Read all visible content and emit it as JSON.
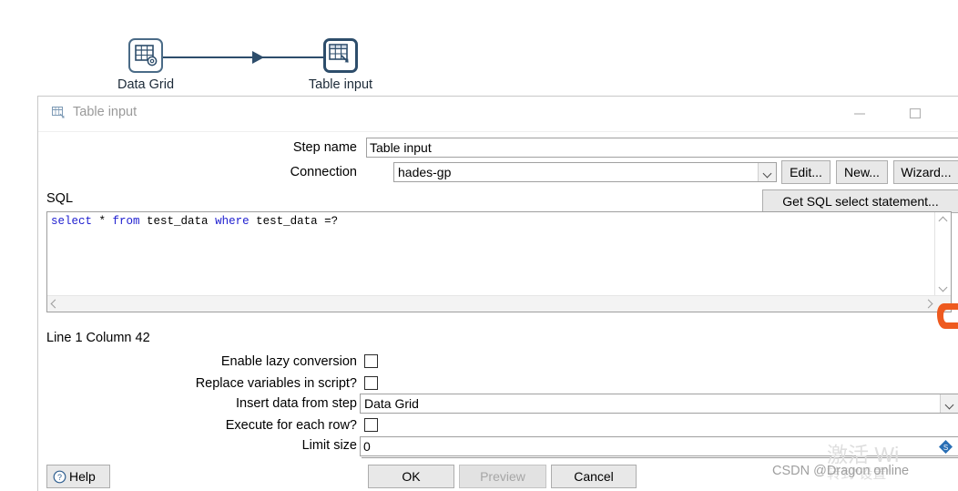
{
  "canvas": {
    "steps": [
      {
        "name": "Data Grid",
        "icon": "data-grid-icon"
      },
      {
        "name": "Table input",
        "icon": "table-input-icon"
      }
    ],
    "hop": {
      "name": "hop-arrow"
    }
  },
  "dialog": {
    "title": "Table input",
    "title_icon": "table-input-small-icon",
    "window_controls": {
      "minimize": "minimize-icon",
      "maximize": "maximize-icon",
      "close": "close-icon"
    },
    "fields": {
      "step_name_label": "Step name",
      "step_name_value": "Table input",
      "connection_label": "Connection",
      "connection_value": "hades-gp"
    },
    "connection_buttons": [
      {
        "label": "Edit...",
        "name": "edit-connection-button"
      },
      {
        "label": "New...",
        "name": "new-connection-button"
      },
      {
        "label": "Wizard...",
        "name": "connection-wizard-button"
      }
    ],
    "sql": {
      "label": "SQL",
      "get_statement_button": "Get SQL select statement...",
      "tokens": [
        {
          "t": "select",
          "kw": true
        },
        {
          "t": " * ",
          "kw": false
        },
        {
          "t": "from",
          "kw": true
        },
        {
          "t": " test_data ",
          "kw": false
        },
        {
          "t": "where",
          "kw": true
        },
        {
          "t": " test_data =?",
          "kw": false
        }
      ],
      "plain_text": "select * from test_data where test_data =?",
      "status": "Line 1 Column 42"
    },
    "options": {
      "lazy_conversion_label": "Enable lazy conversion",
      "lazy_conversion_checked": false,
      "replace_variables_label": "Replace variables in script?",
      "replace_variables_checked": false,
      "insert_data_label": "Insert data from step",
      "insert_data_value": "Data Grid",
      "execute_each_row_label": "Execute for each row?",
      "execute_each_row_checked": false,
      "limit_size_label": "Limit size",
      "limit_size_value": "0"
    },
    "footer": {
      "help_label": "Help",
      "ok_label": "OK",
      "preview_label": "Preview",
      "preview_disabled": true,
      "cancel_label": "Cancel"
    }
  },
  "watermarks": {
    "csdn": "CSDN @Dragon online",
    "windows_main": "激活 Wi",
    "windows_sub": "转到\"设置\""
  },
  "colors": {
    "step_outline": "#2d4d6b",
    "keyword_blue": "#2020d0",
    "title_grey": "#9a9a9a",
    "orange": "#ee5a1f"
  }
}
